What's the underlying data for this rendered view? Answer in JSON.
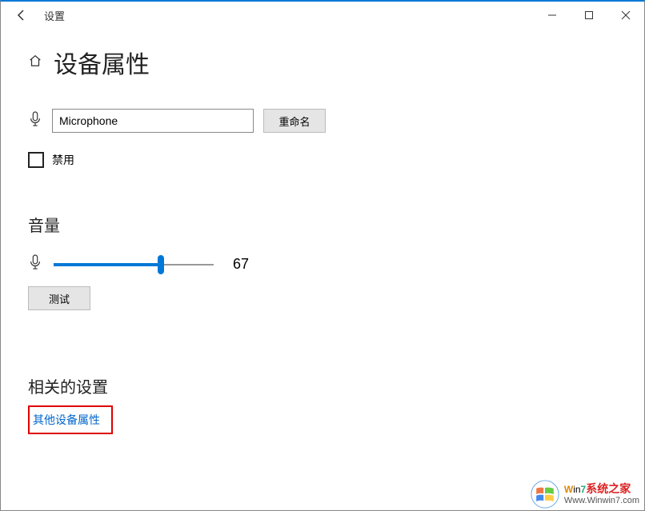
{
  "titlebar": {
    "title": "设置"
  },
  "page": {
    "heading": "设备属性"
  },
  "device": {
    "name_value": "Microphone",
    "rename_label": "重命名",
    "disable_label": "禁用",
    "disabled_checked": false
  },
  "volume": {
    "section_label": "音量",
    "value": 67,
    "test_label": "测试"
  },
  "related": {
    "section_label": "相关的设置",
    "link_label": "其他设备属性"
  },
  "watermark": {
    "brand_prefix": "W",
    "brand_mid": "in",
    "brand_num": "7",
    "brand_cn": "系统之家",
    "url": "Www.Winwin7.com"
  }
}
